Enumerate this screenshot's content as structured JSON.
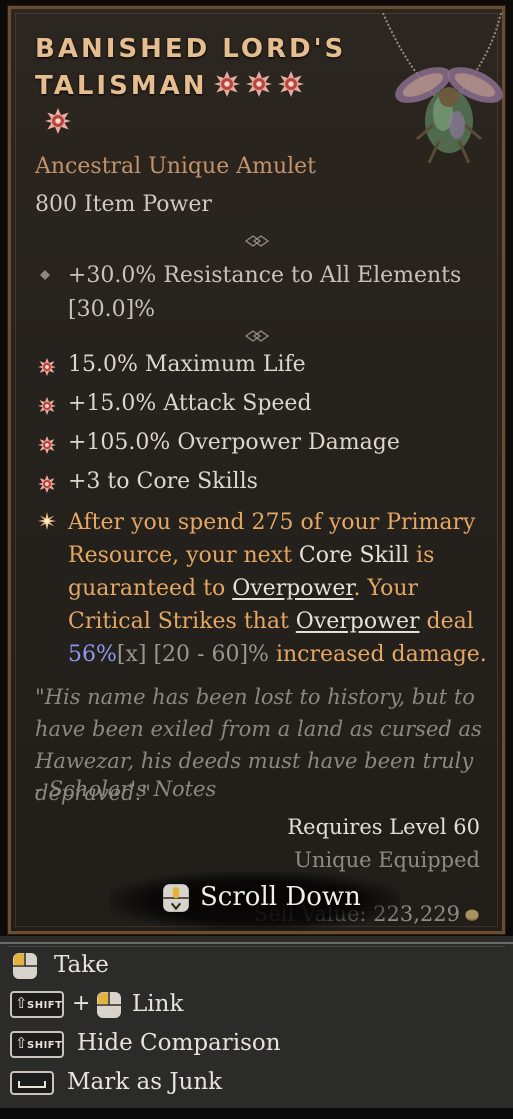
{
  "item": {
    "title": "BANISHED LORD'S TALISMAN",
    "stars": 4,
    "type": "Ancestral Unique Amulet",
    "item_power": "800 Item Power",
    "implicit": {
      "value": "+30.0% Resistance to All Elements",
      "range": "[30.0]%"
    },
    "affixes": [
      "15.0% Maximum Life",
      "+15.0% Attack Speed",
      "+105.0% Overpower Damage",
      "+3 to Core Skills"
    ],
    "unique_power": {
      "p1": "After you spend 275 of your Primary Resource, your next ",
      "core": "Core",
      "p2": " ",
      "skill": "Skill",
      "p3": " is guaranteed to ",
      "overpower1": "Overpower",
      "p4": ". Your Critical Strikes that ",
      "overpower2": "Overpower",
      "p5": " deal ",
      "value": "56%",
      "x": "[x]",
      "range": " [20 - 60]%",
      "p6": " increased damage."
    },
    "flavor_text": "\"His name has been lost to history, but to have been exiled from a land as cursed as Hawezar, his deeds must have been truly depraved.\"",
    "flavor_source": "- Scholar's Notes",
    "requires_level": "Requires Level 60",
    "unique_equipped": "Unique Equipped",
    "sell_value": "Sell Value: 223,229",
    "scroll_label": "Scroll Down"
  },
  "actions": {
    "take": "Take",
    "link": "Link",
    "hide_comparison": "Hide Comparison",
    "mark_as_junk": "Mark as Junk",
    "shift_key": "SHIFT",
    "plus": "+"
  },
  "colors": {
    "title": "#e6bd8f",
    "unique_orange": "#e5a764",
    "border": "#6a4d33",
    "value_blue": "#8f97ef"
  },
  "icons": [
    "unique-star-icon",
    "amulet-beetle-icon",
    "diamond-bullet-icon",
    "mouse-icon",
    "shift-key-icon",
    "space-key-icon",
    "gold-coin-icon"
  ]
}
